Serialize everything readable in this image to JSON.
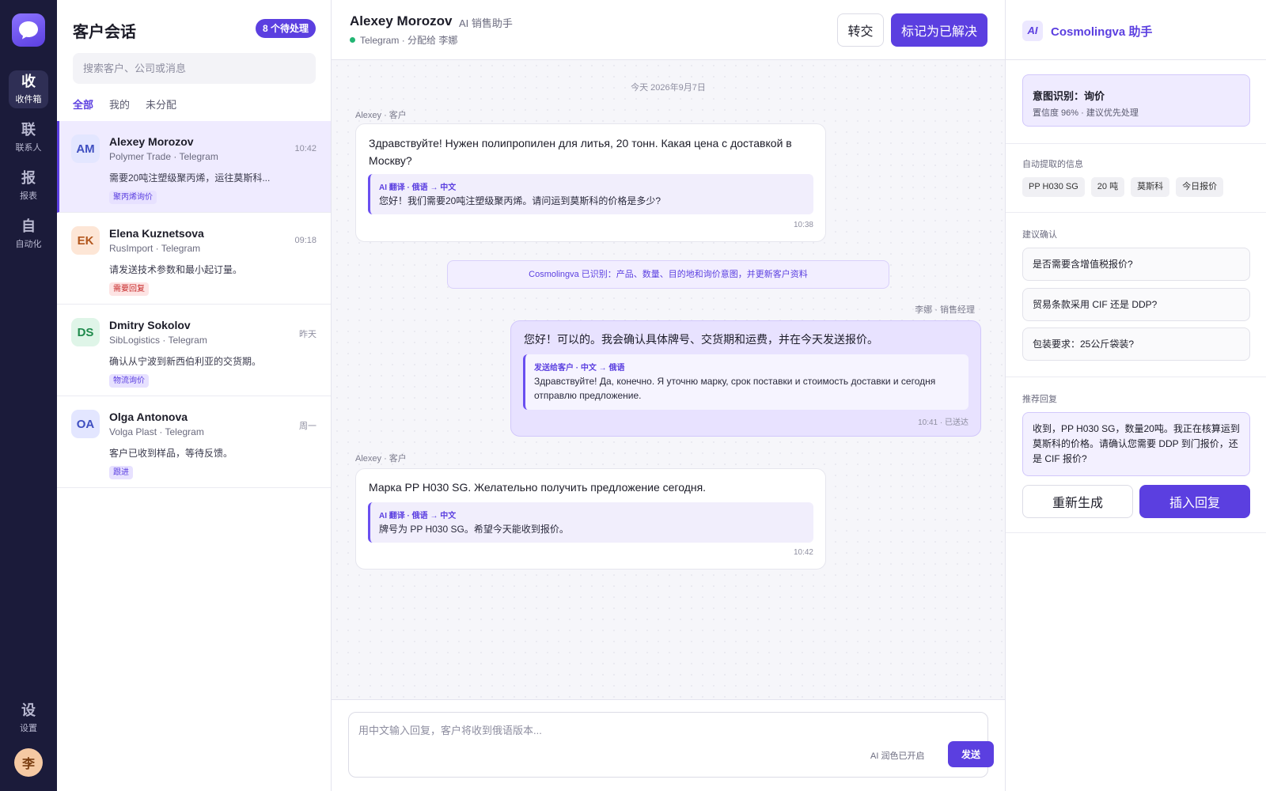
{
  "rail": {
    "items": [
      {
        "glyph": "收",
        "label": "收件箱"
      },
      {
        "glyph": "联",
        "label": "联系人"
      },
      {
        "glyph": "报",
        "label": "报表"
      },
      {
        "glyph": "自",
        "label": "自动化"
      }
    ],
    "settings": {
      "glyph": "设",
      "label": "设置"
    },
    "avatar": "李"
  },
  "list": {
    "title": "客户会话",
    "pending_badge": "8 个待处理",
    "search_placeholder": "搜索客户、公司或消息",
    "filters": [
      "全部",
      "我的",
      "未分配"
    ],
    "conversations": [
      {
        "initials": "AM",
        "name": "Alexey Morozov",
        "company": "Polymer Trade · Telegram",
        "time": "10:42",
        "preview": "需要20吨注塑级聚丙烯，运往莫斯科...",
        "tag": "聚丙烯询价",
        "avatar_bg": "#e3e6ff",
        "avatar_fg": "#3f4fc0",
        "tag_style": "purple"
      },
      {
        "initials": "EK",
        "name": "Elena Kuznetsova",
        "company": "RusImport · Telegram",
        "time": "09:18",
        "preview": "请发送技术参数和最小起订量。",
        "tag": "需要回复",
        "avatar_bg": "#fde6d6",
        "avatar_fg": "#b2561c",
        "tag_style": "red"
      },
      {
        "initials": "DS",
        "name": "Dmitry Sokolov",
        "company": "SibLogistics · Telegram",
        "time": "昨天",
        "preview": "确认从宁波到新西伯利亚的交货期。",
        "tag": "物流询价",
        "avatar_bg": "#dff5e8",
        "avatar_fg": "#1f8a4c",
        "tag_style": "purple"
      },
      {
        "initials": "OA",
        "name": "Olga Antonova",
        "company": "Volga Plast · Telegram",
        "time": "周一",
        "preview": "客户已收到样品，等待反馈。",
        "tag": "跟进",
        "avatar_bg": "#e3e6ff",
        "avatar_fg": "#3f4fc0",
        "tag_style": "purple"
      }
    ]
  },
  "chat": {
    "name": "Alexey Morozov",
    "role": "AI 销售助手",
    "status": "Telegram · 分配给 李娜",
    "transfer_label": "转交",
    "resolve_label": "标记为已解决",
    "date": "今天 2026年9月7日",
    "messages": [
      {
        "sender": "Alexey · 客户",
        "text": "Здравствуйте! Нужен полипропилен для литья, 20 тонн. Какая цена с доставкой в Москву?",
        "translation_label": "AI 翻译 · 俄语 → 中文",
        "translation": "您好！我们需要20吨注塑级聚丙烯。请问运到莫斯科的价格是多少?",
        "time": "10:38"
      },
      {
        "sender": "李娜 · 销售经理",
        "text": "您好！可以的。我会确认具体牌号、交货期和运费，并在今天发送报价。",
        "translation_label": "发送给客户 · 中文 → 俄语",
        "translation": "Здравствуйте! Да, конечно. Я уточню марку, срок поставки и стоимость доставки и сегодня отправлю предложение.",
        "time": "10:41 · 已送达"
      },
      {
        "sender": "Alexey · 客户",
        "text": "Марка PP H030 SG. Желательно получить предложение сегодня.",
        "translation_label": "AI 翻译 · 俄语 → 中文",
        "translation": "牌号为 PP H030 SG。希望今天能收到报价。",
        "time": "10:42"
      }
    ],
    "system_note": "Cosmolingva 已识别：产品、数量、目的地和询价意图，并更新客户资料",
    "composer_placeholder": "用中文输入回复，客户将收到俄语版本...",
    "ai_polish": "AI 润色已开启",
    "send_label": "发送"
  },
  "panel": {
    "logo": "AI",
    "title": "Cosmolingva 助手",
    "intent_title": "意图识别：询价",
    "intent_sub": "置信度 96% · 建议优先处理",
    "extracted_label": "自动提取的信息",
    "chips": [
      "PP H030 SG",
      "20 吨",
      "莫斯科",
      "今日报价"
    ],
    "confirm_label": "建议确认",
    "suggestions": [
      "是否需要含增值税报价?",
      "贸易条款采用 CIF 还是 DDP?",
      "包装要求：25公斤袋装?"
    ],
    "reply_label": "推荐回复",
    "reply_text": "收到，PP H030 SG，数量20吨。我正在核算运到莫斯科的价格。请确认您需要 DDP 到门报价，还是 CIF 报价?",
    "regen_label": "重新生成",
    "insert_label": "插入回复"
  }
}
